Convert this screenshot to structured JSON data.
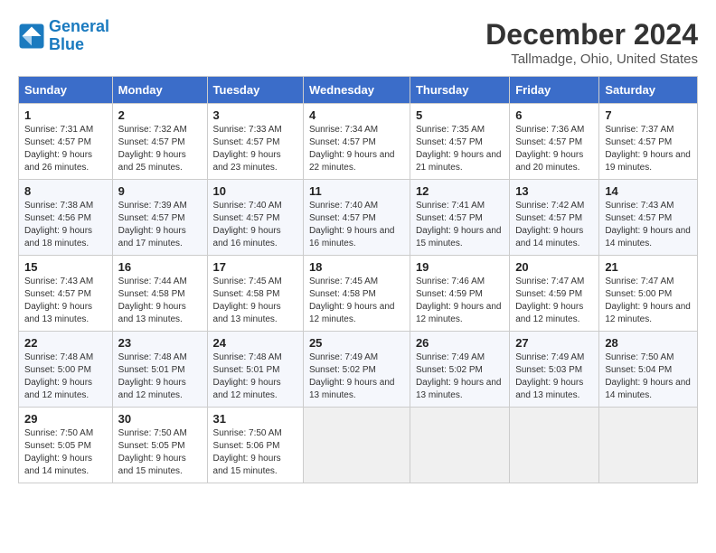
{
  "logo": {
    "line1": "General",
    "line2": "Blue"
  },
  "title": "December 2024",
  "subtitle": "Tallmadge, Ohio, United States",
  "headers": [
    "Sunday",
    "Monday",
    "Tuesday",
    "Wednesday",
    "Thursday",
    "Friday",
    "Saturday"
  ],
  "weeks": [
    [
      {
        "day": "1",
        "sunrise": "Sunrise: 7:31 AM",
        "sunset": "Sunset: 4:57 PM",
        "daylight": "Daylight: 9 hours and 26 minutes."
      },
      {
        "day": "2",
        "sunrise": "Sunrise: 7:32 AM",
        "sunset": "Sunset: 4:57 PM",
        "daylight": "Daylight: 9 hours and 25 minutes."
      },
      {
        "day": "3",
        "sunrise": "Sunrise: 7:33 AM",
        "sunset": "Sunset: 4:57 PM",
        "daylight": "Daylight: 9 hours and 23 minutes."
      },
      {
        "day": "4",
        "sunrise": "Sunrise: 7:34 AM",
        "sunset": "Sunset: 4:57 PM",
        "daylight": "Daylight: 9 hours and 22 minutes."
      },
      {
        "day": "5",
        "sunrise": "Sunrise: 7:35 AM",
        "sunset": "Sunset: 4:57 PM",
        "daylight": "Daylight: 9 hours and 21 minutes."
      },
      {
        "day": "6",
        "sunrise": "Sunrise: 7:36 AM",
        "sunset": "Sunset: 4:57 PM",
        "daylight": "Daylight: 9 hours and 20 minutes."
      },
      {
        "day": "7",
        "sunrise": "Sunrise: 7:37 AM",
        "sunset": "Sunset: 4:57 PM",
        "daylight": "Daylight: 9 hours and 19 minutes."
      }
    ],
    [
      {
        "day": "8",
        "sunrise": "Sunrise: 7:38 AM",
        "sunset": "Sunset: 4:56 PM",
        "daylight": "Daylight: 9 hours and 18 minutes."
      },
      {
        "day": "9",
        "sunrise": "Sunrise: 7:39 AM",
        "sunset": "Sunset: 4:57 PM",
        "daylight": "Daylight: 9 hours and 17 minutes."
      },
      {
        "day": "10",
        "sunrise": "Sunrise: 7:40 AM",
        "sunset": "Sunset: 4:57 PM",
        "daylight": "Daylight: 9 hours and 16 minutes."
      },
      {
        "day": "11",
        "sunrise": "Sunrise: 7:40 AM",
        "sunset": "Sunset: 4:57 PM",
        "daylight": "Daylight: 9 hours and 16 minutes."
      },
      {
        "day": "12",
        "sunrise": "Sunrise: 7:41 AM",
        "sunset": "Sunset: 4:57 PM",
        "daylight": "Daylight: 9 hours and 15 minutes."
      },
      {
        "day": "13",
        "sunrise": "Sunrise: 7:42 AM",
        "sunset": "Sunset: 4:57 PM",
        "daylight": "Daylight: 9 hours and 14 minutes."
      },
      {
        "day": "14",
        "sunrise": "Sunrise: 7:43 AM",
        "sunset": "Sunset: 4:57 PM",
        "daylight": "Daylight: 9 hours and 14 minutes."
      }
    ],
    [
      {
        "day": "15",
        "sunrise": "Sunrise: 7:43 AM",
        "sunset": "Sunset: 4:57 PM",
        "daylight": "Daylight: 9 hours and 13 minutes."
      },
      {
        "day": "16",
        "sunrise": "Sunrise: 7:44 AM",
        "sunset": "Sunset: 4:58 PM",
        "daylight": "Daylight: 9 hours and 13 minutes."
      },
      {
        "day": "17",
        "sunrise": "Sunrise: 7:45 AM",
        "sunset": "Sunset: 4:58 PM",
        "daylight": "Daylight: 9 hours and 13 minutes."
      },
      {
        "day": "18",
        "sunrise": "Sunrise: 7:45 AM",
        "sunset": "Sunset: 4:58 PM",
        "daylight": "Daylight: 9 hours and 12 minutes."
      },
      {
        "day": "19",
        "sunrise": "Sunrise: 7:46 AM",
        "sunset": "Sunset: 4:59 PM",
        "daylight": "Daylight: 9 hours and 12 minutes."
      },
      {
        "day": "20",
        "sunrise": "Sunrise: 7:47 AM",
        "sunset": "Sunset: 4:59 PM",
        "daylight": "Daylight: 9 hours and 12 minutes."
      },
      {
        "day": "21",
        "sunrise": "Sunrise: 7:47 AM",
        "sunset": "Sunset: 5:00 PM",
        "daylight": "Daylight: 9 hours and 12 minutes."
      }
    ],
    [
      {
        "day": "22",
        "sunrise": "Sunrise: 7:48 AM",
        "sunset": "Sunset: 5:00 PM",
        "daylight": "Daylight: 9 hours and 12 minutes."
      },
      {
        "day": "23",
        "sunrise": "Sunrise: 7:48 AM",
        "sunset": "Sunset: 5:01 PM",
        "daylight": "Daylight: 9 hours and 12 minutes."
      },
      {
        "day": "24",
        "sunrise": "Sunrise: 7:48 AM",
        "sunset": "Sunset: 5:01 PM",
        "daylight": "Daylight: 9 hours and 12 minutes."
      },
      {
        "day": "25",
        "sunrise": "Sunrise: 7:49 AM",
        "sunset": "Sunset: 5:02 PM",
        "daylight": "Daylight: 9 hours and 13 minutes."
      },
      {
        "day": "26",
        "sunrise": "Sunrise: 7:49 AM",
        "sunset": "Sunset: 5:02 PM",
        "daylight": "Daylight: 9 hours and 13 minutes."
      },
      {
        "day": "27",
        "sunrise": "Sunrise: 7:49 AM",
        "sunset": "Sunset: 5:03 PM",
        "daylight": "Daylight: 9 hours and 13 minutes."
      },
      {
        "day": "28",
        "sunrise": "Sunrise: 7:50 AM",
        "sunset": "Sunset: 5:04 PM",
        "daylight": "Daylight: 9 hours and 14 minutes."
      }
    ],
    [
      {
        "day": "29",
        "sunrise": "Sunrise: 7:50 AM",
        "sunset": "Sunset: 5:05 PM",
        "daylight": "Daylight: 9 hours and 14 minutes."
      },
      {
        "day": "30",
        "sunrise": "Sunrise: 7:50 AM",
        "sunset": "Sunset: 5:05 PM",
        "daylight": "Daylight: 9 hours and 15 minutes."
      },
      {
        "day": "31",
        "sunrise": "Sunrise: 7:50 AM",
        "sunset": "Sunset: 5:06 PM",
        "daylight": "Daylight: 9 hours and 15 minutes."
      },
      null,
      null,
      null,
      null
    ]
  ]
}
